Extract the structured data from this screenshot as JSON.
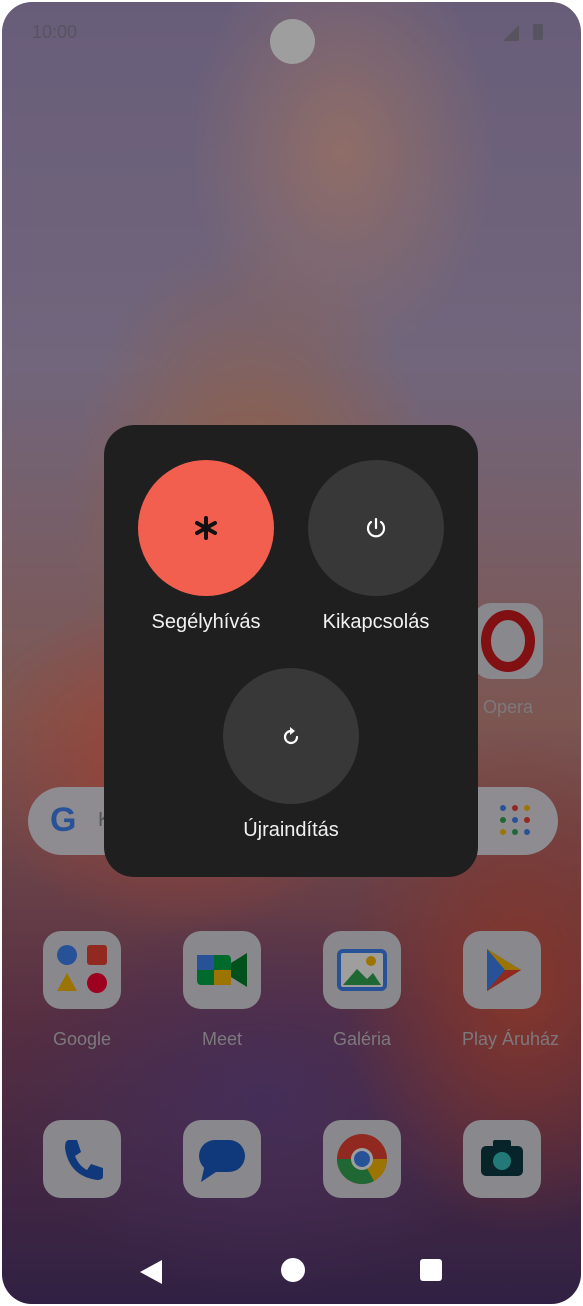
{
  "status_bar": {
    "time": "10:00"
  },
  "home": {
    "side_apps": [
      {
        "label": "Opera"
      }
    ],
    "search": {
      "placeholder": "K"
    },
    "apps_row": [
      {
        "label": "Google"
      },
      {
        "label": "Meet"
      },
      {
        "label": "Galéria"
      },
      {
        "label": "Play Áruház"
      }
    ],
    "dock": [
      {
        "name": "phone-icon"
      },
      {
        "name": "messages-icon"
      },
      {
        "name": "chrome-icon"
      },
      {
        "name": "camera-icon"
      }
    ]
  },
  "power_menu": {
    "emergency_label": "Segélyhívás",
    "power_off_label": "Kikapcsolás",
    "restart_label": "Újraindítás",
    "accent_color": "#f35f4f"
  }
}
